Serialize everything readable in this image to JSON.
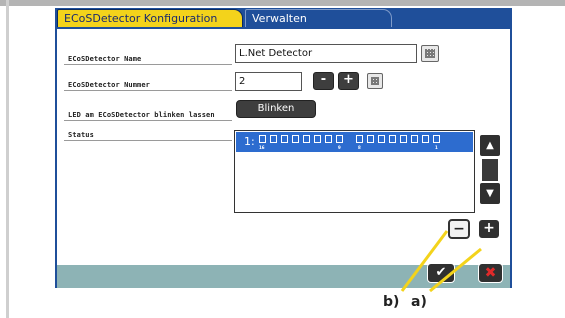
{
  "tabs": [
    {
      "label": "ECoSDetector Konfiguration",
      "active": true
    },
    {
      "label": "Verwalten",
      "active": false
    }
  ],
  "fields": {
    "name": {
      "label": "ECoSDetector Name",
      "value": "L.Net Detector"
    },
    "number": {
      "label": "ECoSDetector Nummer",
      "value": "2",
      "minus": "-",
      "plus": "+"
    },
    "blink": {
      "label": "LED am ECoSDetector blinken lassen",
      "button": "Blinken"
    },
    "status": {
      "label": "Status"
    }
  },
  "status_list": {
    "rows": [
      {
        "id": "1:",
        "led_numbers": [
          "16",
          "9",
          "8",
          "1"
        ]
      }
    ],
    "scroll_up": "▲",
    "scroll_down": "▼"
  },
  "list_controls": {
    "remove": "−",
    "add": "+"
  },
  "bottom": {
    "ok": "✔",
    "cancel": "✖"
  },
  "callouts": {
    "b": "b)",
    "a": "a)"
  },
  "colors": {
    "accent_yellow": "#f3d31b",
    "window_blue": "#1f4f9a",
    "selection_blue": "#2d6ccf",
    "bottom_bar": "#8db3b5",
    "cancel_red": "#e02a2a"
  }
}
